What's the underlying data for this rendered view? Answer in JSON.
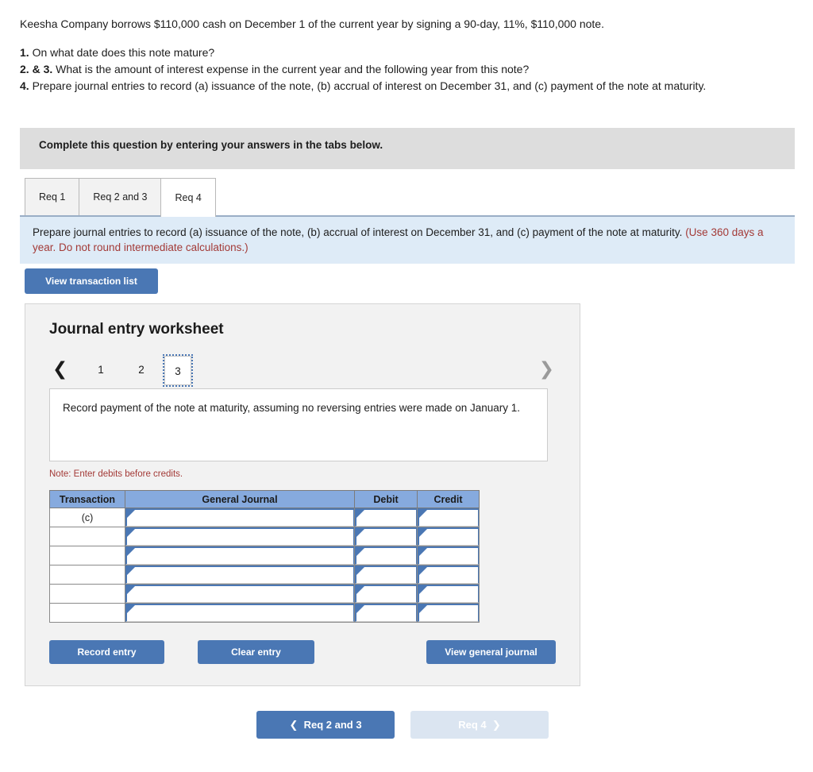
{
  "problem": {
    "lead": "Keesha Company borrows $110,000 cash on December 1 of the current year by signing a 90-day, 11%, $110,000 note.",
    "requirements": [
      {
        "num": "1.",
        "text": "On what date does this note mature?"
      },
      {
        "num": "2. & 3.",
        "text": "What is the amount of interest expense in the current year and the following year from this note?"
      },
      {
        "num": "4.",
        "text": "Prepare journal entries to record (a) issuance of the note, (b) accrual of interest on December 31, and (c) payment of the note at maturity."
      }
    ]
  },
  "gray_banner": {
    "text": "Complete this question by entering your answers in the tabs below."
  },
  "tabs": [
    {
      "label": "Req 1",
      "active": false
    },
    {
      "label": "Req 2 and 3",
      "active": false
    },
    {
      "label": "Req 4",
      "active": true
    }
  ],
  "blue_banner": {
    "main_text": "Prepare journal entries to record (a) issuance of the note, (b) accrual of interest on December 31, and (c) payment of the note at maturity.",
    "red_text": "(Use 360 days a year. Do not round intermediate calculations.)"
  },
  "toolbar": {
    "view_transaction_list": "View transaction list"
  },
  "worksheet": {
    "title": "Journal entry worksheet",
    "pager": {
      "prev_icon": "chevron-left-icon",
      "next_icon": "chevron-right-icon",
      "pages": [
        "1",
        "2",
        "3"
      ],
      "selected": "3"
    },
    "prompt": "Record payment of the note at maturity, assuming no reversing entries were made on January 1.",
    "note": "Note: Enter debits before credits.",
    "table": {
      "columns": [
        "Transaction",
        "General Journal",
        "Debit",
        "Credit"
      ],
      "rows": [
        {
          "transaction": "(c)",
          "general_journal": "",
          "debit": "",
          "credit": ""
        },
        {
          "transaction": "",
          "general_journal": "",
          "debit": "",
          "credit": ""
        },
        {
          "transaction": "",
          "general_journal": "",
          "debit": "",
          "credit": ""
        },
        {
          "transaction": "",
          "general_journal": "",
          "debit": "",
          "credit": ""
        },
        {
          "transaction": "",
          "general_journal": "",
          "debit": "",
          "credit": ""
        },
        {
          "transaction": "",
          "general_journal": "",
          "debit": "",
          "credit": ""
        }
      ]
    },
    "actions": {
      "record_entry": "Record entry",
      "clear_entry": "Clear entry",
      "view_general_journal": "View general journal"
    }
  },
  "bottom_nav": {
    "prev_label": "Req 2 and 3",
    "prev_icon": "chevron-left-icon",
    "next_label": "Req 4",
    "next_icon": "chevron-right-icon",
    "next_disabled": true
  },
  "colors": {
    "accent_blue": "#4a77b4",
    "table_header_blue": "#86aade",
    "banner_blue": "#deebf7",
    "banner_gray": "#dddddd",
    "red": "#a33a37",
    "disabled_blue": "#dbe5f1"
  }
}
